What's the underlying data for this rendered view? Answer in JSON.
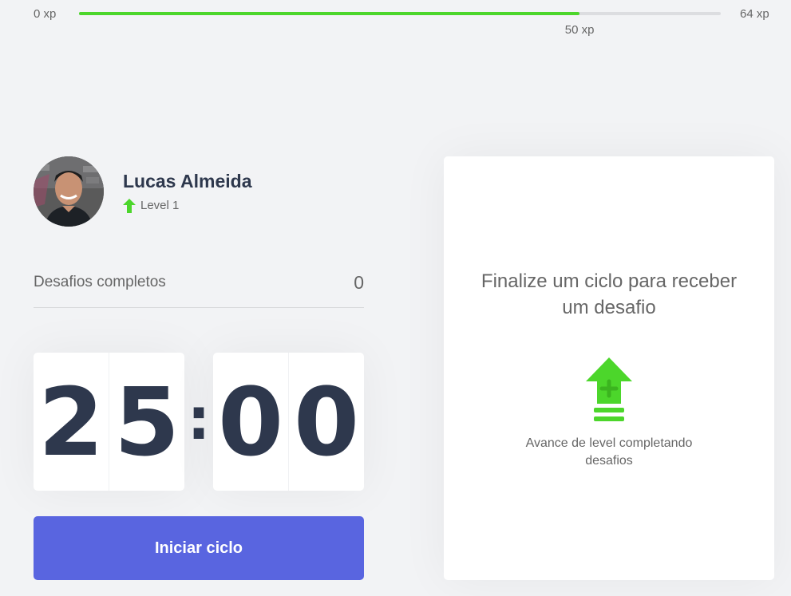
{
  "xp": {
    "min_label": "0 xp",
    "max_label": "64 xp",
    "current_label": "50 xp",
    "progress_fraction": 0.78,
    "bar_color": "#4cd62b"
  },
  "profile": {
    "name": "Lucas Almeida",
    "level_label": "Level 1",
    "level_icon": "level-up-arrow-icon"
  },
  "challenges": {
    "completed_label": "Desafios completos",
    "completed_value": "0"
  },
  "countdown": {
    "minute_tens": "2",
    "minute_ones": "5",
    "separator": ":",
    "second_tens": "0",
    "second_ones": "0"
  },
  "actions": {
    "start_label": "Iniciar ciclo",
    "button_color": "#5965e0"
  },
  "challenge_box": {
    "title": "Finalize um ciclo para receber um desafio",
    "icon": "level-up-icon",
    "hint": "Avance de level completando desafios"
  }
}
